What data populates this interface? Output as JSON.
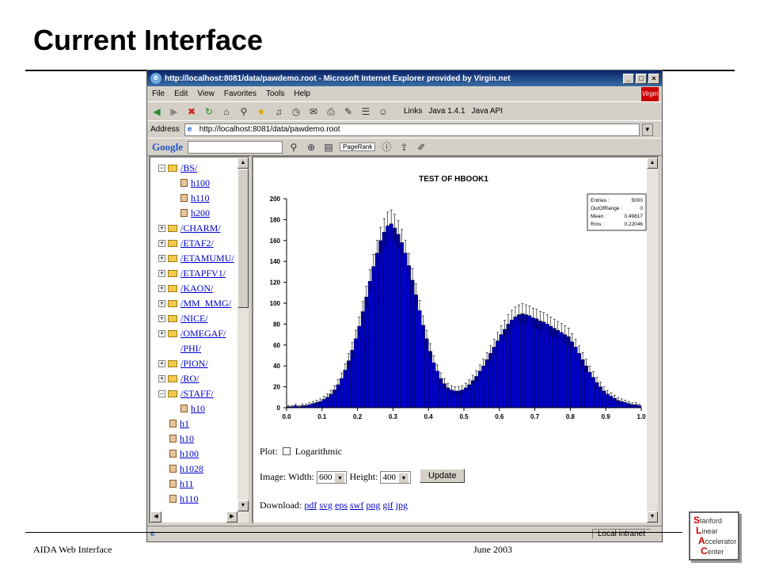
{
  "slide": {
    "title": "Current Interface",
    "footer_left": "AIDA Web Interface",
    "footer_center": "June 2003",
    "logo_lines": [
      {
        "initial": "S",
        "rest": "tanford"
      },
      {
        "initial": "L",
        "rest": "inear"
      },
      {
        "initial": "A",
        "rest": "ccelerator"
      },
      {
        "initial": "C",
        "rest": "enter"
      }
    ]
  },
  "browser": {
    "title": "http://localhost:8081/data/pawdemo.root - Microsoft Internet Explorer provided by Virgin.net",
    "menu": [
      "File",
      "Edit",
      "View",
      "Favorites",
      "Tools",
      "Help"
    ],
    "virgin_logo": "Virgin",
    "toolbar_icons": [
      "back-icon",
      "forward-icon",
      "stop-icon",
      "refresh-icon",
      "home-icon",
      "search-icon",
      "favorites-icon",
      "media-icon",
      "history-icon",
      "mail-icon",
      "print-icon",
      "edit-icon",
      "discuss-icon",
      "messenger-icon"
    ],
    "links_label": "Links",
    "links": [
      "Java 1.4.1",
      "Java API"
    ],
    "address_label": "Address",
    "address_value": "http://localhost:8081/data/pawdemo.root",
    "google_label": "Google",
    "pagerank_label": "PageRank",
    "status_zone": "Local intranet"
  },
  "tree": {
    "items": [
      {
        "label": "/BS/",
        "kind": "folder",
        "expander": "⊟",
        "indent": 0
      },
      {
        "label": "h100",
        "kind": "file",
        "indent": 1
      },
      {
        "label": "h110",
        "kind": "file",
        "indent": 1
      },
      {
        "label": "h200",
        "kind": "file",
        "indent": 1
      },
      {
        "label": "/CHARM/",
        "kind": "folder",
        "expander": "⊞",
        "indent": 0
      },
      {
        "label": "/ETAF2/",
        "kind": "folder",
        "expander": "⊞",
        "indent": 0
      },
      {
        "label": "/ETAMUMU/",
        "kind": "folder",
        "expander": "⊞",
        "indent": 0
      },
      {
        "label": "/ETAPFV1/",
        "kind": "folder",
        "expander": "⊞",
        "indent": 0
      },
      {
        "label": "/KAON/",
        "kind": "folder",
        "expander": "⊞",
        "indent": 0
      },
      {
        "label": "/MM_MMG/",
        "kind": "folder",
        "expander": "⊞",
        "indent": 0
      },
      {
        "label": "/NICE/",
        "kind": "folder",
        "expander": "⊞",
        "indent": 0
      },
      {
        "label": "/OMEGAF/",
        "kind": "folder",
        "expander": "⊞",
        "indent": 0
      },
      {
        "label": "/PHI/",
        "kind": "plain",
        "indent": 0
      },
      {
        "label": "/PION/",
        "kind": "folder",
        "expander": "⊞",
        "indent": 0
      },
      {
        "label": "/RO/",
        "kind": "folder",
        "expander": "⊞",
        "indent": 0
      },
      {
        "label": "/STAFF/",
        "kind": "folder",
        "expander": "⊟",
        "indent": 0
      },
      {
        "label": "h10",
        "kind": "file",
        "indent": 1
      },
      {
        "label": "h1",
        "kind": "file",
        "indent": -1
      },
      {
        "label": "h10",
        "kind": "file",
        "indent": -1
      },
      {
        "label": "h100",
        "kind": "file",
        "indent": -1
      },
      {
        "label": "h1028",
        "kind": "file",
        "indent": -1
      },
      {
        "label": "h11",
        "kind": "file",
        "indent": -1
      },
      {
        "label": "h110",
        "kind": "file",
        "indent": -1
      }
    ]
  },
  "form": {
    "plot_label": "Plot:",
    "log_label": "Logarithmic",
    "log_checked": false,
    "image_label": "Image: Width:",
    "width_value": "600",
    "height_label": "Height:",
    "height_value": "400",
    "update_label": "Update",
    "download_label": "Download:",
    "download_links": [
      "pdf",
      "svg",
      "eps",
      "swf",
      "png",
      "gif",
      "jpg"
    ]
  },
  "chart_data": {
    "type": "bar",
    "title": "TEST OF HBOOK1",
    "xlim": [
      0.0,
      1.0
    ],
    "ylim": [
      0,
      200
    ],
    "xticks": [
      "0.0",
      "0.1",
      "0.2",
      "0.3",
      "0.4",
      "0.5",
      "0.6",
      "0.7",
      "0.8",
      "0.9",
      "1.0"
    ],
    "yticks": [
      "0",
      "20",
      "40",
      "60",
      "80",
      "100",
      "120",
      "140",
      "160",
      "180",
      "200"
    ],
    "stats": [
      {
        "name": "Entries :",
        "value": "5000"
      },
      {
        "name": "OutOfRange :",
        "value": "0"
      },
      {
        "name": "Mean :",
        "value": "0.49817"
      },
      {
        "name": "Rms :",
        "value": "0.22046"
      }
    ],
    "bar_color": "#0000cc",
    "bin_width": 0.01,
    "values": [
      1,
      1,
      2,
      1,
      2,
      2,
      3,
      4,
      5,
      6,
      8,
      10,
      13,
      17,
      22,
      28,
      36,
      45,
      55,
      66,
      78,
      92,
      106,
      121,
      135,
      148,
      160,
      168,
      174,
      176,
      172,
      166,
      158,
      148,
      136,
      122,
      108,
      93,
      79,
      66,
      54,
      43,
      35,
      28,
      23,
      19,
      17,
      16,
      16,
      17,
      19,
      22,
      26,
      30,
      35,
      40,
      46,
      52,
      58,
      64,
      70,
      75,
      80,
      84,
      87,
      89,
      90,
      89,
      88,
      86,
      85,
      83,
      82,
      80,
      78,
      76,
      74,
      72,
      70,
      68,
      63,
      58,
      52,
      46,
      40,
      34,
      29,
      24,
      20,
      16,
      13,
      11,
      9,
      7,
      6,
      5,
      4,
      3,
      3,
      2
    ]
  }
}
